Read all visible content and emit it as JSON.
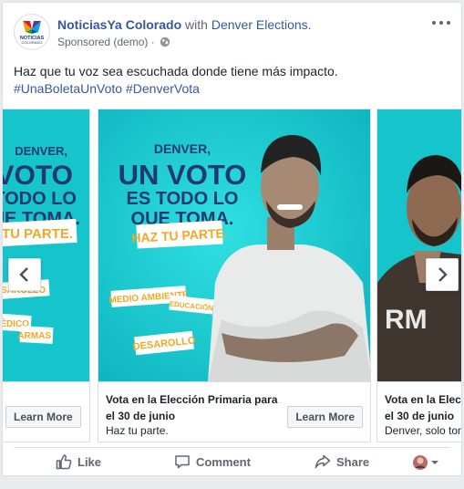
{
  "post": {
    "page_name": "NoticiasYa Colorado",
    "with_text": "with",
    "with_page": "Denver Elections.",
    "sponsored": "Sponsored (demo) ·",
    "caption": "Haz que tu voz sea escuchada donde tiene más impacto.",
    "hashtags": "#UnaBoletaUnVoto #DenverVota"
  },
  "logo": {
    "line1": "NOTICIAS",
    "line2": "COLORADO"
  },
  "ad": {
    "denver": "DENVER,",
    "un_voto": "UN VOTO",
    "es_todo": "ES TODO LO",
    "que_toma": "QUE TOMA.",
    "haz": "HAZ TU PARTE.",
    "tag1": "MEDIO AMBIENTE",
    "tag2": "EDUCACIÓN",
    "tag3": "DESAROLLO",
    "left_voto": "VOTO",
    "left_todo": "TODO LO",
    "left_toma": "UE TOMA.",
    "left_haz": "AZ TU PARTE.",
    "left_tag1": "DESAROLLO",
    "left_tag2": "MÉDICO",
    "left_tag3": "ARMAS",
    "right_shirt": "RM"
  },
  "cards": [
    {
      "cta": "Learn More"
    },
    {
      "title": "Vota en la Elección Primaria para el 30 de junio",
      "desc": "Haz tu parte.",
      "cta": "Learn More"
    },
    {
      "title": "Vota en la Elecc",
      "title2": "el 30 de junio",
      "desc": "Denver, solo tom"
    }
  ],
  "actions": {
    "like": "Like",
    "comment": "Comment",
    "share": "Share"
  },
  "colors": {
    "link": "#365899",
    "teal": "#14c6cc",
    "navy": "#1f3a6e",
    "orange": "#f5a623"
  }
}
